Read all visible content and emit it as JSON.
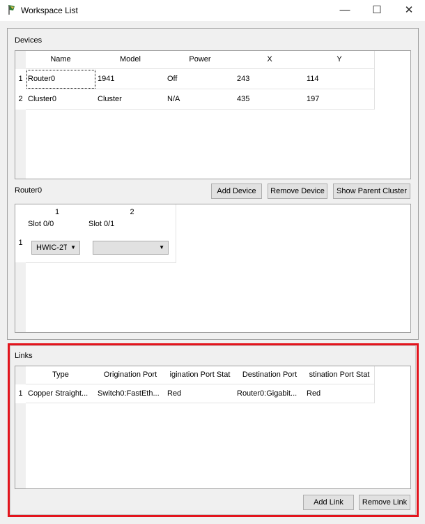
{
  "window": {
    "title": "Workspace List",
    "minimize": "—",
    "maximize": "☐",
    "close": "✕"
  },
  "devices": {
    "label": "Devices",
    "columns": [
      "Name",
      "Model",
      "Power",
      "X",
      "Y"
    ],
    "rows": [
      {
        "num": "1",
        "cells": [
          "Router0",
          "1941",
          "Off",
          "243",
          "114"
        ]
      },
      {
        "num": "2",
        "cells": [
          "Cluster0",
          "Cluster",
          "N/A",
          "435",
          "197"
        ]
      }
    ]
  },
  "selected": {
    "label": "Router0",
    "add_device": "Add Device",
    "remove_device": "Remove Device",
    "show_parent": "Show Parent Cluster"
  },
  "slots": {
    "columns": [
      "1",
      "2"
    ],
    "row_num": "1",
    "slots": [
      {
        "label": "Slot 0/0",
        "value": "HWIC-2T"
      },
      {
        "label": "Slot 0/1",
        "value": ""
      }
    ]
  },
  "links": {
    "label": "Links",
    "columns": [
      "Type",
      "Origination Port",
      "igination Port Stat",
      "Destination Port",
      "stination Port Stat"
    ],
    "rows": [
      {
        "num": "1",
        "cells": [
          "Copper Straight...",
          "Switch0:FastEth...",
          "Red",
          "Router0:Gigabit...",
          "Red"
        ]
      }
    ],
    "add_link": "Add Link",
    "remove_link": "Remove Link"
  },
  "highlight_color": "#e3141c"
}
